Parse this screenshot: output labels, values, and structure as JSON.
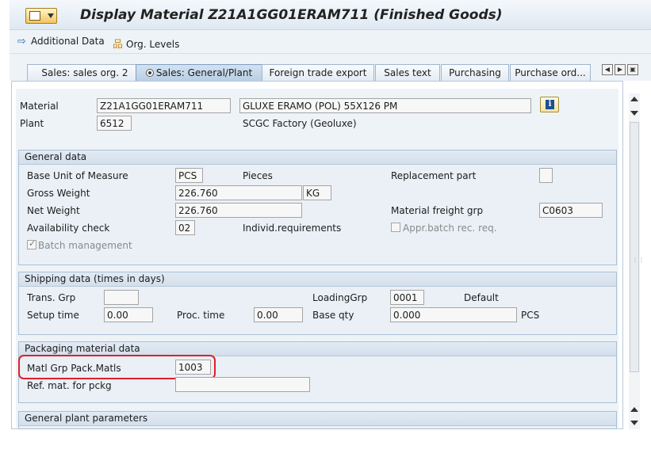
{
  "title": "Display Material Z21A1GG01ERAM711 (Finished Goods)",
  "toolbar": {
    "additional_data": "Additional Data",
    "org_levels": "Org. Levels"
  },
  "tabs": [
    {
      "label": "Sales: sales org. 2",
      "active": false
    },
    {
      "label": "Sales: General/Plant",
      "active": true
    },
    {
      "label": "Foreign trade export",
      "active": false
    },
    {
      "label": "Sales text",
      "active": false
    },
    {
      "label": "Purchasing",
      "active": false
    },
    {
      "label": "Purchase ord...",
      "active": false
    }
  ],
  "header": {
    "material_label": "Material",
    "material_value": "Z21A1GG01ERAM711",
    "material_desc": "GLUXE ERAMO (POL) 55X126 PM",
    "plant_label": "Plant",
    "plant_value": "6512",
    "plant_desc": "SCGC Factory (Geoluxe)"
  },
  "general_data": {
    "title": "General data",
    "base_uom_label": "Base Unit of Measure",
    "base_uom_value": "PCS",
    "base_uom_desc": "Pieces",
    "replacement_part_label": "Replacement part",
    "gross_weight_label": "Gross Weight",
    "gross_weight_value": "226.760",
    "weight_unit": "KG",
    "net_weight_label": "Net Weight",
    "net_weight_value": "226.760",
    "freight_grp_label": "Material freight grp",
    "freight_grp_value": "C0603",
    "availability_label": "Availability check",
    "availability_value": "02",
    "availability_desc": "Individ.requirements",
    "appr_batch_label": "Appr.batch rec. req.",
    "batch_mgmt_label": "Batch management"
  },
  "shipping_data": {
    "title": "Shipping data (times in days)",
    "trans_grp_label": "Trans. Grp",
    "trans_grp_value": "",
    "loading_grp_label": "LoadingGrp",
    "loading_grp_value": "0001",
    "loading_grp_desc": "Default",
    "setup_time_label": "Setup time",
    "setup_time_value": "0.00",
    "proc_time_label": "Proc. time",
    "proc_time_value": "0.00",
    "base_qty_label": "Base qty",
    "base_qty_value": "0.000",
    "base_qty_unit": "PCS"
  },
  "packaging_data": {
    "title": "Packaging material data",
    "matl_grp_label": "Matl Grp Pack.Matls",
    "matl_grp_value": "1003",
    "ref_mat_label": "Ref. mat. for pckg",
    "ref_mat_value": ""
  },
  "general_plant": {
    "title": "General plant parameters"
  },
  "colors": {
    "highlight": "#e0202a",
    "group_border": "#a9bfd3",
    "background": "#eef3f8"
  }
}
